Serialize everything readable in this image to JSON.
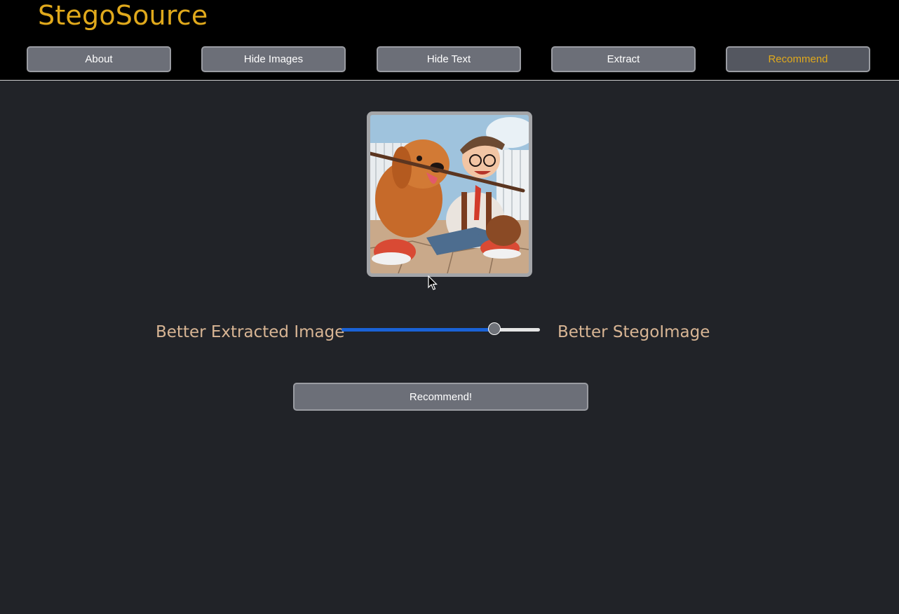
{
  "brand": {
    "title": "StegoSource"
  },
  "nav": {
    "items": [
      {
        "label": "About"
      },
      {
        "label": "Hide Images"
      },
      {
        "label": "Hide Text"
      },
      {
        "label": "Extract"
      },
      {
        "label": "Recommend"
      }
    ],
    "active": "Recommend"
  },
  "main": {
    "image": {
      "description_icon": "preview-image"
    },
    "slider": {
      "left_label": "Better Extracted Image",
      "right_label": "Better StegoImage",
      "value": 0.77
    },
    "action": {
      "label": "Recommend!"
    }
  },
  "colors": {
    "accent": "#e0a91c",
    "background": "#212328",
    "header": "#000000",
    "button": "#6c6f78",
    "slider_fill": "#1a62d6",
    "label": "#d8b594"
  }
}
